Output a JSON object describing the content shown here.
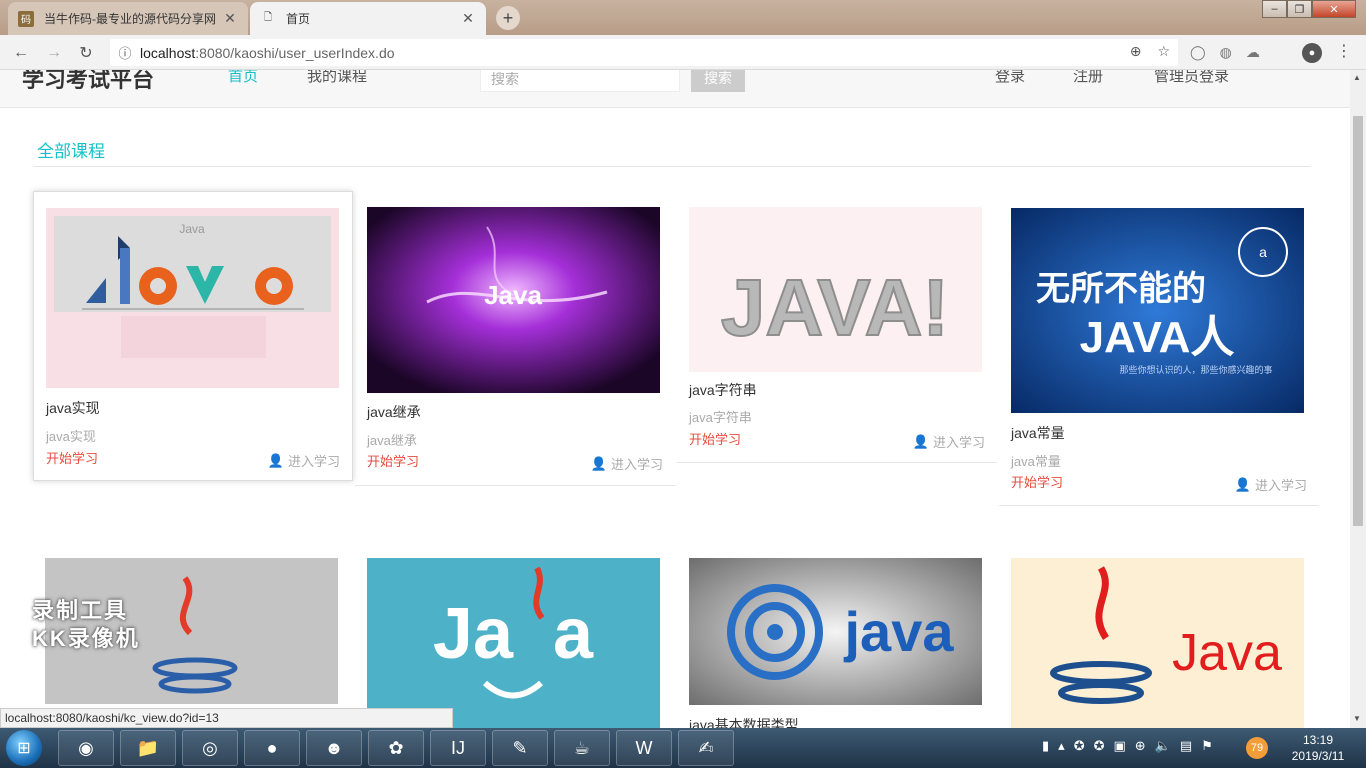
{
  "browser": {
    "tabs": [
      {
        "title": "当牛作码-最专业的源代码分享网"
      },
      {
        "title": "首页"
      }
    ],
    "url_host": "localhost",
    "url_path": ":8080/kaoshi/user_userIndex.do"
  },
  "site": {
    "logo": "学习考试平台",
    "nav": {
      "home": "首页",
      "my_courses": "我的课程",
      "login": "登录",
      "register": "注册",
      "admin_login": "管理员登录"
    },
    "search": {
      "placeholder": "搜索",
      "button": "搜索"
    }
  },
  "section_title": "全部课程",
  "courses": [
    {
      "name": "java实现",
      "desc": "java实现",
      "start": "开始学习",
      "enter": "进入学习",
      "image": "Java (triangles)"
    },
    {
      "name": "java继承",
      "desc": "java继承",
      "start": "开始学习",
      "enter": "进入学习",
      "image": "Java (purple)"
    },
    {
      "name": "java字符串",
      "desc": "java字符串",
      "start": "开始学习",
      "enter": "进入学习",
      "image": "JAVA! 3D"
    },
    {
      "name": "java常量",
      "desc": "java常量",
      "start": "开始学习",
      "enter": "进入学习",
      "image": "无所不能的JAVA人"
    },
    {
      "name": "",
      "desc": "",
      "start": "",
      "enter": "",
      "image": "Java cup"
    },
    {
      "name": "",
      "desc": "",
      "start": "",
      "enter": "",
      "image": "Java blue"
    },
    {
      "name": "java基本数据类型",
      "desc": "",
      "start": "",
      "enter": "",
      "image": "java target"
    },
    {
      "name": "",
      "desc": "",
      "start": "",
      "enter": "",
      "image": "Java logo"
    }
  ],
  "thumb_text": {
    "java_tri": "Java",
    "java_purple": "Java",
    "java_3d": "JAVA!",
    "java_ali_line1": "无所不能的",
    "java_ali_line2": "JAVA人",
    "java_ali_sub": "那些你想认识的人，那些你感兴趣的事",
    "java_blue": "Ja  a",
    "java_target": "java",
    "java_logo": "Java"
  },
  "status_url": "localhost:8080/kaoshi/kc_view.do?id=13",
  "watermark": {
    "line1": "录制工具",
    "line2": "KK录像机"
  },
  "taskbar": {
    "badge": "79",
    "time": "13:19",
    "date": "2019/3/11"
  },
  "colors": {
    "accent": "#17c0c8",
    "start": "#e74c3c"
  }
}
